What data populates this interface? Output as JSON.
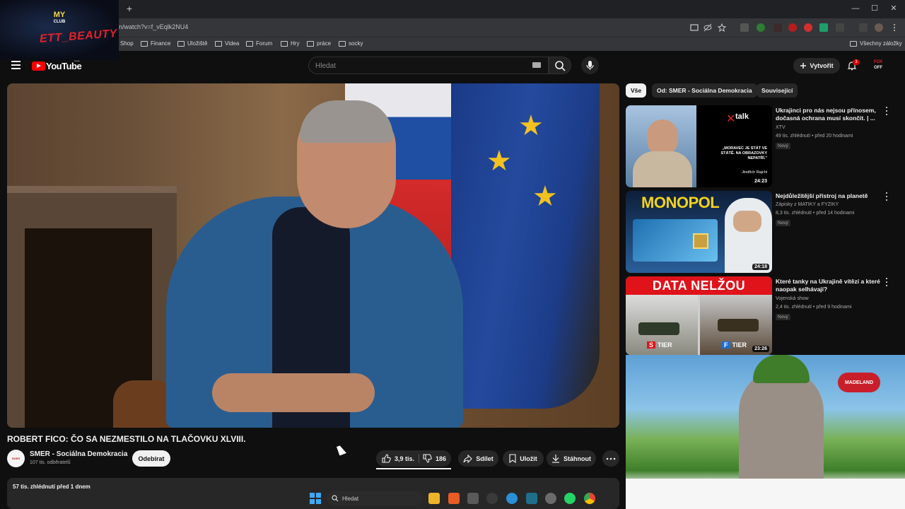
{
  "overlay": {
    "club_top": "MY",
    "club_sub": "CLUB",
    "brand": "ETT_BEAUTY"
  },
  "browser": {
    "new_tab": "+",
    "url": "n/watch?v=f_vEqlk2NU4",
    "win_min": "—",
    "win_max": "☐",
    "win_close": "✕",
    "bookmarks": [
      "Shop",
      "Finance",
      "Uložiště",
      "Videa",
      "Forum",
      "Hry",
      "práce",
      "socky"
    ],
    "all_bookmarks": "Všechny záložky"
  },
  "youtube": {
    "wordmark": "YouTube",
    "country": "CZ",
    "search_placeholder": "Hledat",
    "create_label": "Vytvořit",
    "notif_count": "3",
    "avatar_top": "FOX",
    "avatar_bottom": "OFF"
  },
  "video": {
    "title": "ROBERT FICO: ČO SA NEZMESTILO NA TLAČOVKU XLVIII.",
    "channel": "SMER - Sociálna Demokracia",
    "channel_avatar": "SMER",
    "subscribers": "107 tis. odběratelů",
    "subscribe_label": "Odebírat",
    "likes": "3,9 tis.",
    "dislikes": "186",
    "share_label": "Sdílet",
    "save_label": "Uložit",
    "download_label": "Stáhnout",
    "meta": "57 tis. zhlédnutí  před 1 dnem"
  },
  "chips": [
    "Vše",
    "Od: SMER - Sociálna Demokracia",
    "Související"
  ],
  "recommendations": [
    {
      "title": "Ukrajinci pro nás nejsou přínosem, dočasná ochrana musí skončit. | ...",
      "channel": "XTV",
      "meta": "49 tis. zhlédnutí • před 20 hodinami",
      "badge": "Nový",
      "duration": "24:23",
      "thumb_brand": "talk",
      "thumb_quote": "„MORAVEC JE STÁT VE STÁTĚ. NA OBRAZOVKY NEPATŘÍ.\"",
      "thumb_name": "Jindřich Rajchl"
    },
    {
      "title": "Nejdůležitější přístroj na planetě",
      "channel": "Zápisky z MATIKY a FYZIKY",
      "meta": "8,3 tis. zhlédnutí • před 14 hodinami",
      "badge": "Nový",
      "duration": "24:18",
      "thumb_text": "MONOPOL"
    },
    {
      "title": "Které tanky na Ukrajině vítězí a které naopak selhávají?",
      "channel": "Vojenská show",
      "meta": "2,4 tis. zhlédnutí • před 9 hodinami",
      "badge": "Nový",
      "duration": "23:26",
      "thumb_text": "DATA NELŽOU",
      "tier_s": "S",
      "tier_f": "F",
      "tier_label": "TIER"
    }
  ],
  "ad": {
    "brand": "MADELAND"
  },
  "taskbar": {
    "search_label": "Hledat"
  },
  "colors": {
    "youtube_red": "#ff0000",
    "background": "#0f0f0f",
    "surface": "#272727",
    "notif": "#cc0000"
  }
}
